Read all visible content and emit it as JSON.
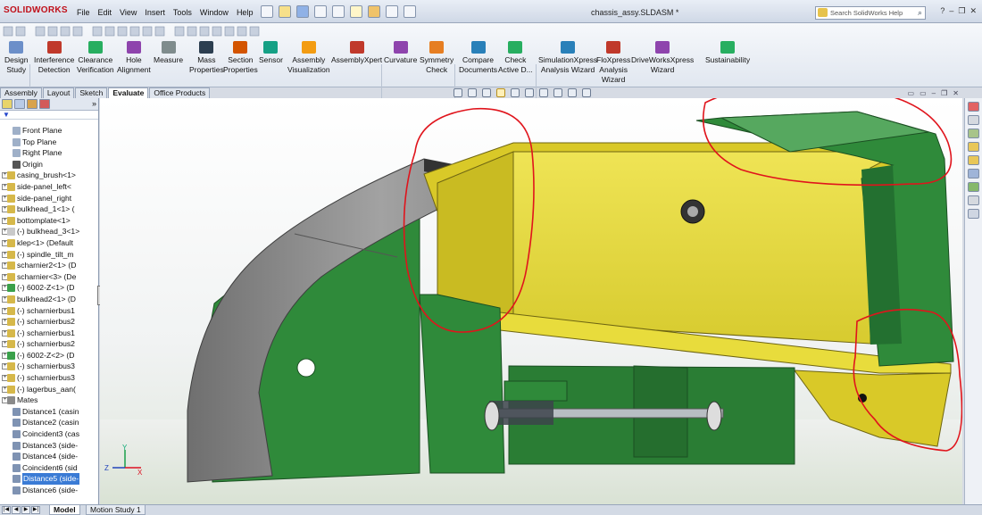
{
  "app": {
    "logo": "SOLIDWORKS",
    "doc_title": "chassis_assy.SLDASM *"
  },
  "menu": [
    "File",
    "Edit",
    "View",
    "Insert",
    "Tools",
    "Window",
    "Help"
  ],
  "search": {
    "placeholder": "Search SolidWorks Help"
  },
  "ribbon": [
    {
      "label": "Design\nStudy",
      "color": "#6c8fc9"
    },
    {
      "label": "Interference\nDetection",
      "color": "#c0392b"
    },
    {
      "label": "Clearance\nVerification",
      "color": "#27ae60"
    },
    {
      "label": "Hole\nAlignment",
      "color": "#8e44ad"
    },
    {
      "label": "Measure",
      "color": "#7f8c8d"
    },
    {
      "label": "Mass\nProperties",
      "color": "#2c3e50"
    },
    {
      "label": "Section\nProperties",
      "color": "#d35400"
    },
    {
      "label": "Sensor",
      "color": "#16a085"
    },
    {
      "label": "Assembly\nVisualization",
      "color": "#f39c12"
    },
    {
      "label": "AssemblyXpert",
      "color": "#c0392b"
    },
    {
      "label": "Curvature",
      "color": "#8e44ad"
    },
    {
      "label": "Symmetry\nCheck",
      "color": "#e67e22"
    },
    {
      "label": "Compare\nDocuments",
      "color": "#2980b9"
    },
    {
      "label": "Check\nActive D...",
      "color": "#27ae60"
    },
    {
      "label": "SimulationXpress\nAnalysis Wizard",
      "color": "#2980b9"
    },
    {
      "label": "FloXpress\nAnalysis\nWizard",
      "color": "#c0392b"
    },
    {
      "label": "DriveWorksXpress\nWizard",
      "color": "#8e44ad"
    },
    {
      "label": "Sustainability",
      "color": "#27ae60"
    }
  ],
  "command_tabs": [
    "Assembly",
    "Layout",
    "Sketch",
    "Evaluate",
    "Office Products"
  ],
  "command_tabs_active": "Evaluate",
  "tree": [
    {
      "label": "Front Plane",
      "indent": 1,
      "icon": "plane"
    },
    {
      "label": "Top Plane",
      "indent": 1,
      "icon": "plane"
    },
    {
      "label": "Right Plane",
      "indent": 1,
      "icon": "plane"
    },
    {
      "label": "Origin",
      "indent": 1,
      "icon": "origin"
    },
    {
      "label": "casing_brush<1>",
      "indent": 0,
      "icon": "part",
      "exp": true
    },
    {
      "label": "side-panel_left<",
      "indent": 0,
      "icon": "part",
      "exp": true
    },
    {
      "label": "side-panel_right",
      "indent": 0,
      "icon": "part",
      "exp": true
    },
    {
      "label": "bulkhead_1<1> (",
      "indent": 0,
      "icon": "part",
      "exp": true
    },
    {
      "label": "bottomplate<1>",
      "indent": 0,
      "icon": "part",
      "exp": true
    },
    {
      "label": "(-) bulkhead_3<1>",
      "indent": 0,
      "icon": "suppressed",
      "exp": true
    },
    {
      "label": "klep<1> (Default",
      "indent": 0,
      "icon": "part",
      "exp": true
    },
    {
      "label": "(-) spindle_tilt_m",
      "indent": 0,
      "icon": "part",
      "exp": true
    },
    {
      "label": "scharnier2<1> (D",
      "indent": 0,
      "icon": "part",
      "exp": true
    },
    {
      "label": "scharnier<3> (De",
      "indent": 0,
      "icon": "part",
      "exp": true
    },
    {
      "label": "(-) 6002-Z<1> (D",
      "indent": 0,
      "icon": "bearing",
      "exp": true
    },
    {
      "label": "bulkhead2<1> (D",
      "indent": 0,
      "icon": "part",
      "exp": true
    },
    {
      "label": "(-) scharnierbus1",
      "indent": 0,
      "icon": "part",
      "exp": true
    },
    {
      "label": "(-) scharnierbus2",
      "indent": 0,
      "icon": "part",
      "exp": true
    },
    {
      "label": "(-) scharnierbus1",
      "indent": 0,
      "icon": "part",
      "exp": true
    },
    {
      "label": "(-) scharnierbus2",
      "indent": 0,
      "icon": "part",
      "exp": true
    },
    {
      "label": "(-) 6002-Z<2> (D",
      "indent": 0,
      "icon": "bearing",
      "exp": true
    },
    {
      "label": "(-) scharnierbus3",
      "indent": 0,
      "icon": "part",
      "exp": true
    },
    {
      "label": "(-) scharnierbus3",
      "indent": 0,
      "icon": "part",
      "exp": true
    },
    {
      "label": "(-) lagerbus_aan(",
      "indent": 0,
      "icon": "part",
      "exp": true
    },
    {
      "label": "Mates",
      "indent": 0,
      "icon": "mates",
      "exp": true
    },
    {
      "label": "Distance1 (casin",
      "indent": 1,
      "icon": "mate"
    },
    {
      "label": "Distance2 (casin",
      "indent": 1,
      "icon": "mate"
    },
    {
      "label": "Coincident3 (cas",
      "indent": 1,
      "icon": "mate"
    },
    {
      "label": "Distance3 (side-",
      "indent": 1,
      "icon": "mate"
    },
    {
      "label": "Distance4 (side-",
      "indent": 1,
      "icon": "mate"
    },
    {
      "label": "Coincident6 (sid",
      "indent": 1,
      "icon": "mate"
    },
    {
      "label": "Distance5 (side-",
      "indent": 1,
      "icon": "mate",
      "selected": true
    },
    {
      "label": "Distance6 (side-",
      "indent": 1,
      "icon": "mate"
    }
  ],
  "bottom_tabs": [
    "Model",
    "Motion Study 1"
  ],
  "bottom_tabs_active": "Model",
  "triad": {
    "x": "X",
    "y": "Y",
    "z": "Z"
  },
  "colors": {
    "part_green": "#2f8a3a",
    "part_yellow": "#e3d52a",
    "casing_grey": "#8f8f8f",
    "annotation_red": "#e0141c"
  }
}
